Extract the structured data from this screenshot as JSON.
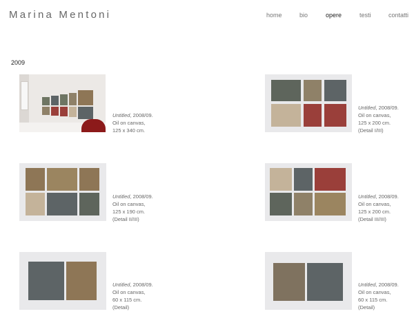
{
  "site": {
    "title": "Marina Mentoni"
  },
  "nav": [
    {
      "label": "home",
      "active": false
    },
    {
      "label": "bio",
      "active": false
    },
    {
      "label": "opere",
      "active": true
    },
    {
      "label": "testi",
      "active": false
    },
    {
      "label": "contatti",
      "active": false
    }
  ],
  "section": {
    "year": "2009"
  },
  "works": [
    {
      "title": "Untitled",
      "year": ", 2008/09.",
      "medium": "Oil on canvas,",
      "size": "125 x 340 cm.",
      "detail": ""
    },
    {
      "title": "Untitled",
      "year": ", 2008/09.",
      "medium": "Oil on canvas,",
      "size": "125 x 200 cm.",
      "detail": "(Detail I/III)"
    },
    {
      "title": "Untitled",
      "year": ", 2008/09.",
      "medium": "Oil on canvas,",
      "size": "125 x 190 cm.",
      "detail": "(Detail II/III)"
    },
    {
      "title": "Untitled",
      "year": ", 2008/09.",
      "medium": "Oil on canvas,",
      "size": "125 x 200 cm.",
      "detail": "(Detail III/III)"
    },
    {
      "title": "Untitled",
      "year": ", 2008/09.",
      "medium": "Oil on canvas,",
      "size": "60 x 115 cm.",
      "detail": "(Detail)"
    },
    {
      "title": "Untitled",
      "year": ", 2008/09.",
      "medium": "Oil on canvas,",
      "size": "60 x 115 cm.",
      "detail": "(Detail)"
    }
  ],
  "colors": {
    "olive": "#6e7563",
    "grey_green": "#5e655c",
    "tan": "#8f8168",
    "sand": "#c4b39a",
    "red": "#9a3f3a",
    "slate": "#5d6466",
    "brown": "#8e7656",
    "khaki": "#9b8560",
    "taupe": "#7f725f",
    "chair_red": "#8c1a1a"
  }
}
